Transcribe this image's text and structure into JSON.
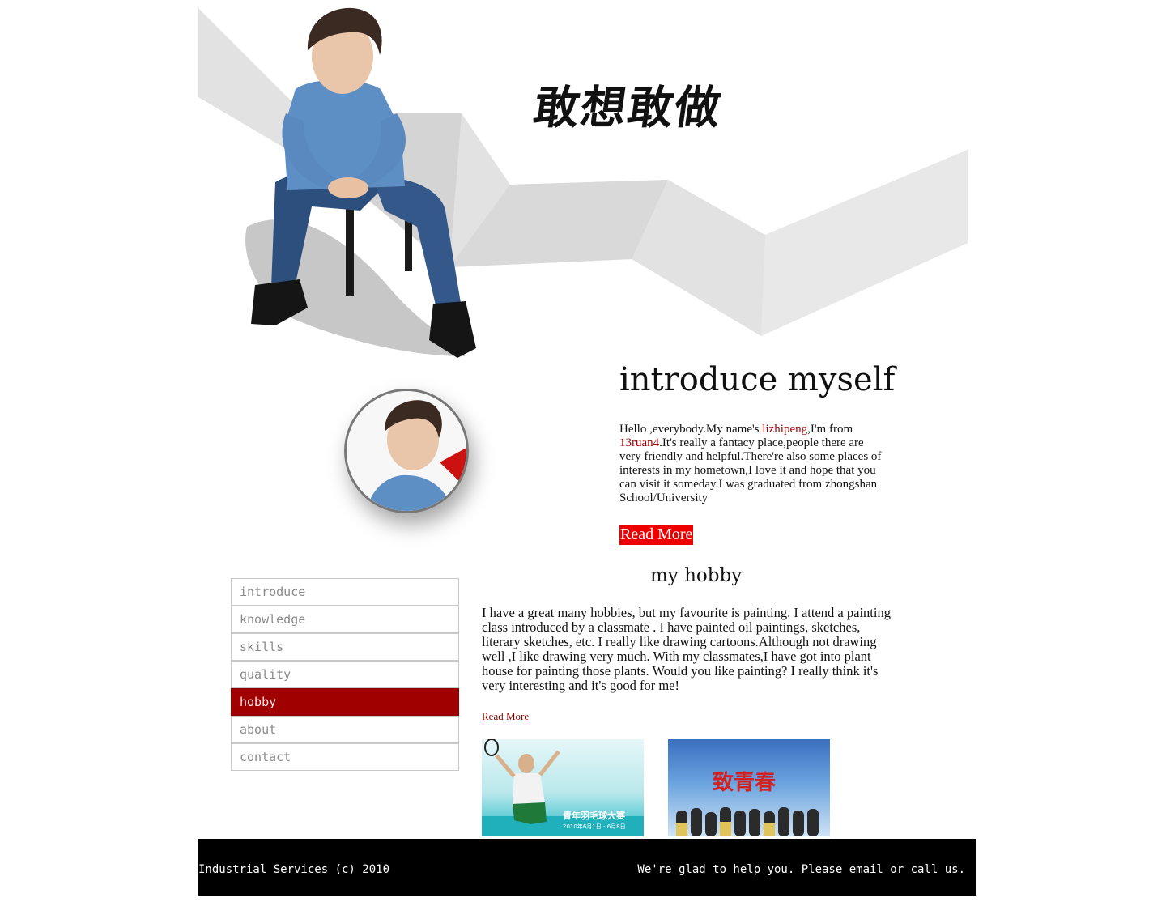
{
  "header": {
    "title": "敢想敢做"
  },
  "intro": {
    "title": "introduce myself",
    "text_before_name": "Hello ,everybody.My name's ",
    "name": "lizhipeng",
    "text_after_name": ",I'm from ",
    "hometown": "13ruan4",
    "text_rest": ".It's really a fantacy place,people there are very friendly and helpful.There're also some places of interests in my hometown,I love it and hope that you can visit it someday.I was graduated from zhongshan School/University",
    "read_more": "Read More",
    "accent_color": "#ee0000"
  },
  "hobby": {
    "title": "my hobby",
    "text": "I have a great many hobbies, but my favourite is painting. I attend a painting class introduced by a classmate . I have painted oil paintings, sketches, literary sketches, etc. I really like drawing cartoons.Although not drawing well ,I like drawing very much. With my classmates,I have got into plant house for painting those plants. Would you like painting? I really think it's very interesting and it's good for me!",
    "read_more": "Read More",
    "photos": [
      {
        "icon": "badminton-poster-image",
        "banner": "青年羽毛球大赛",
        "date": "2010年6月1日 - 6月8日"
      },
      {
        "icon": "youth-poster-image",
        "banner": "致青春"
      }
    ]
  },
  "nav": {
    "items": [
      {
        "label": "introduce",
        "active": false
      },
      {
        "label": "knowledge",
        "active": false
      },
      {
        "label": "skills",
        "active": false
      },
      {
        "label": "quality",
        "active": false
      },
      {
        "label": "hobby",
        "active": true
      },
      {
        "label": "about",
        "active": false
      },
      {
        "label": "contact",
        "active": false
      }
    ],
    "active_color": "#a00000"
  },
  "footer": {
    "left": "Industrial Services (c) 2010",
    "right": "We're glad to help you. Please email or call us.",
    "background": "#000000"
  }
}
